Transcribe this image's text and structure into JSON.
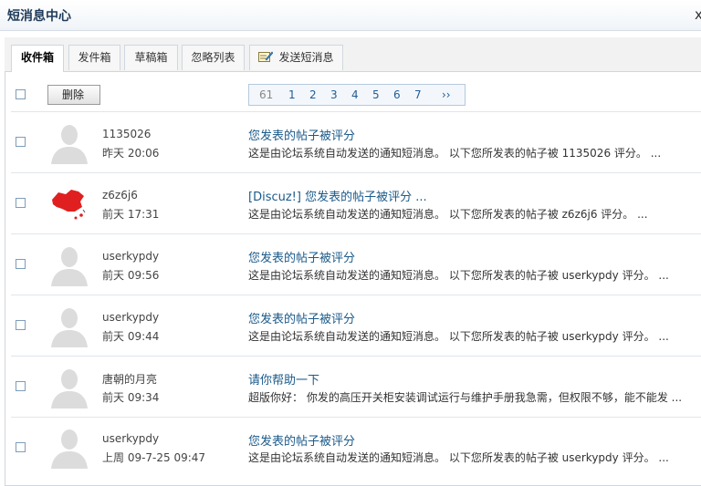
{
  "window": {
    "title": "短消息中心",
    "close_label": "x"
  },
  "tabs": [
    {
      "label": "收件箱",
      "active": true
    },
    {
      "label": "发件箱",
      "active": false
    },
    {
      "label": "草稿箱",
      "active": false
    },
    {
      "label": "忽略列表",
      "active": false
    },
    {
      "label": "发送短消息",
      "active": false,
      "icon": "compose-icon"
    }
  ],
  "toolbar": {
    "delete_label": "删除"
  },
  "pager": {
    "current": "61",
    "pages": [
      "1",
      "2",
      "3",
      "4",
      "5",
      "6",
      "7"
    ],
    "next_label": "››"
  },
  "messages": [
    {
      "sender": "1135026",
      "time": "昨天  20:06",
      "subject": "您发表的帖子被评分",
      "preview": "这是由论坛系统自动发送的通知短消息。  以下您所发表的帖子被  1135026 评分。  ...",
      "avatar": "default-avatar"
    },
    {
      "sender": "z6z6j6",
      "time": "前天  17:31",
      "subject": "[Discuz!] 您发表的帖子被评分 ...",
      "preview": "这是由论坛系统自动发送的通知短消息。  以下您所发表的帖子被  z6z6j6 评分。  ...",
      "avatar": "china-map-avatar"
    },
    {
      "sender": "userkypdy",
      "time": "前天  09:56",
      "subject": "您发表的帖子被评分",
      "preview": "这是由论坛系统自动发送的通知短消息。  以下您所发表的帖子被  userkypdy 评分。  ...",
      "avatar": "default-avatar"
    },
    {
      "sender": "userkypdy",
      "time": "前天  09:44",
      "subject": "您发表的帖子被评分",
      "preview": "这是由论坛系统自动发送的通知短消息。  以下您所发表的帖子被  userkypdy 评分。  ...",
      "avatar": "default-avatar"
    },
    {
      "sender": "唐朝的月亮",
      "time": "前天  09:34",
      "subject": "请你帮助一下",
      "preview": "超版你好：  你发的高压开关柜安装调试运行与维护手册我急需，但权限不够，能不能发  ...",
      "avatar": "default-avatar"
    },
    {
      "sender": "userkypdy",
      "time": "上周  09-7-25 09:47",
      "subject": "您发表的帖子被评分",
      "preview": "这是由论坛系统自动发送的通知短消息。  以下您所发表的帖子被  userkypdy 评分。  ...",
      "avatar": "default-avatar"
    }
  ],
  "colors": {
    "link": "#1b5a8a",
    "border": "#cfd7df",
    "title": "#1f3a5a"
  }
}
